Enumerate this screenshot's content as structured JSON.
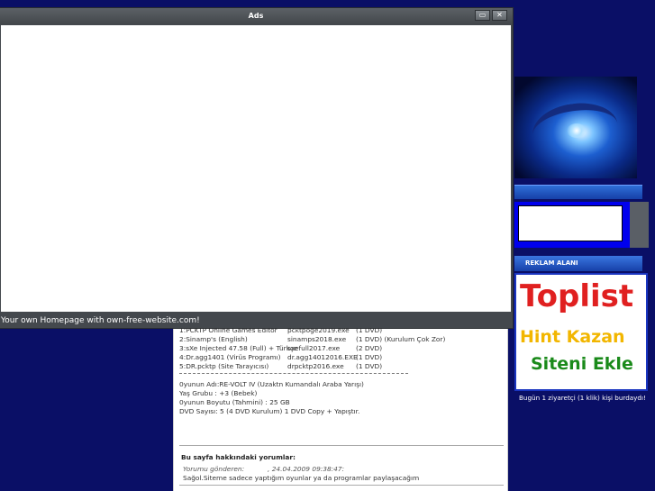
{
  "popup": {
    "title": "Ads",
    "minimize_icon": "minimize-icon",
    "close_icon": "close-icon",
    "footer_text": "Your own Homepage with own-free-website.com!"
  },
  "file_list": [
    {
      "name": "1:PCKTP Online Games Editor",
      "exe": "pcktpoge2019.exe",
      "size": "(1 DVD)"
    },
    {
      "name": "2:Sinamp's (English)",
      "exe": "sinamps2018.exe",
      "size": "(1 DVD) (Kurulum Çok Zor)"
    },
    {
      "name": "3:sXe Injected 47.58 (Full) + Türkçe",
      "exe": "sxefull2017.exe",
      "size": "(2 DVD)"
    },
    {
      "name": "4:Dr.agg1401 (Virüs Programı)",
      "exe": "dr.agg14012016.EXE",
      "size": "(1 DVD)"
    },
    {
      "name": "5:DR.pcktp (Site Tarayıcısı)",
      "exe": "drpcktp2016.exe",
      "size": "(1 DVD)"
    }
  ],
  "game_info": [
    "0yunun Adı:RE-VOLT IV (Uzaktn Kumandalı Araba Yarışı)",
    "Yaş Grubu : +3 (Bebek)",
    "0yunun Boyutu (Tahmini) : 25 GB",
    "DVD Sayısı: 5 (4 DVD Kurulum) 1 DVD Copy + Yapıştır."
  ],
  "comments": {
    "heading": "Bu sayfa hakkındaki yorumlar:",
    "sender_label": "Yorumu gönderen:",
    "date": ", 24.04.2009 09:38:47:",
    "text": "Sağol.Siteme sadece yaptığım oyunlar ya da programlar paylaşacağım"
  },
  "sidebar": {
    "reklam_label": "REKLAM ALANI",
    "toplist_title": "Toplist",
    "toplist_line1": "Hint Kazan",
    "toplist_line2": "Siteni Ekle",
    "visitor_text": "Bugün 1 ziyaretçi (1 klik) kişi burdaydı!"
  },
  "colors": {
    "page_background": "#0a0f66",
    "toplist_red": "#e02020",
    "toplist_yellow": "#f2b600",
    "toplist_green": "#1a8a1a"
  }
}
